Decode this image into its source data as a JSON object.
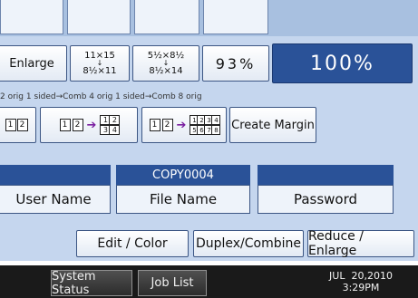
{
  "top_tabs": [
    "",
    "",
    "",
    ""
  ],
  "reduce_enlarge": {
    "enlarge_label": "Enlarge",
    "preset1_line1": "11×15",
    "preset1_arrow": "↓",
    "preset1_line2": "8½×11",
    "preset2_line1": "5½×8½",
    "preset2_arrow": "↓",
    "preset2_line2": "8½×14",
    "zoom_value": "93%",
    "full_size_label": "100%"
  },
  "combine": {
    "hint": "2 orig 1 sided→Comb 4 orig 1 sided→Comb 8 orig",
    "comb2": [
      "1",
      "2"
    ],
    "comb4_src": [
      "1",
      "2"
    ],
    "comb4_dst": [
      "1",
      "2",
      "3",
      "4"
    ],
    "comb8_src": [
      "1",
      "2"
    ],
    "comb8_dst": [
      "1",
      "2",
      "3",
      "4",
      "5",
      "6",
      "7",
      "8"
    ],
    "create_margin_label": "Create Margin"
  },
  "fields": {
    "user_name_header": "",
    "user_name_label": "User Name",
    "file_name_header": "COPY0004",
    "file_name_label": "File Name",
    "password_header": "",
    "password_label": "Password"
  },
  "tabs": [
    "Edit / Color",
    "Duplex/Combine",
    "Reduce / Enlarge"
  ],
  "status_bar": {
    "system_status_label": "System Status",
    "job_list_label": "Job List",
    "date": "JUL  20,2010",
    "time": "3:29PM"
  },
  "colors": {
    "accent_blue": "#2a5298",
    "panel_bg": "#c5d6ee",
    "status_bar_bg": "#1a1a1a"
  }
}
